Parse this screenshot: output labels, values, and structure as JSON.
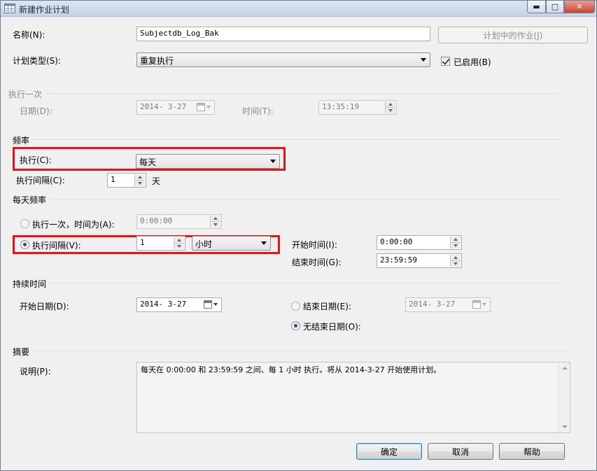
{
  "window": {
    "title": "新建作业计划",
    "min_label": "▬",
    "max_label": "□",
    "close_label": "✕"
  },
  "name": {
    "label": "名称(N):",
    "value": "Subjectdb_Log_Bak",
    "jobs_button": "计划中的作业(J)"
  },
  "schedule_type": {
    "label": "计划类型(S):",
    "value": "重复执行",
    "enabled_label": "已启用(B)",
    "enabled_checked": true
  },
  "one_time": {
    "section": "执行一次",
    "date_label": "日期(D):",
    "date_value": "2014- 3-27",
    "time_label": "时间(T):",
    "time_value": "13:35:19"
  },
  "frequency": {
    "section": "频率",
    "occurs_label": "执行(C):",
    "occurs_value": "每天",
    "recurs_label": "执行间隔(C):",
    "recurs_value": "1",
    "recurs_unit": "天"
  },
  "daily_frequency": {
    "section": "每天频率",
    "once_label": "执行一次，时间为(A):",
    "once_value": "0:00:00",
    "every_label": "执行间隔(V):",
    "every_value": "1",
    "every_unit": "小时",
    "start_time_label": "开始时间(I):",
    "start_time_value": "0:00:00",
    "end_time_label": "结束时间(G):",
    "end_time_value": "23:59:59",
    "selected": "every"
  },
  "duration": {
    "section": "持续时间",
    "start_date_label": "开始日期(D):",
    "start_date_value": "2014- 3-27",
    "end_date_label": "结束日期(E):",
    "end_date_value": "2014- 3-27",
    "no_end_label": "无结束日期(O):",
    "selected": "no_end"
  },
  "summary": {
    "section": "摘要",
    "desc_label": "说明(P):",
    "desc_value": "每天在 0:00:00 和 23:59:59 之间、每 1 小时 执行。将从 2014-3-27 开始使用计划。"
  },
  "buttons": {
    "ok": "确定",
    "cancel": "取消",
    "help": "帮助"
  },
  "colors": {
    "highlight_box": "#e8141c",
    "dialog_bg": "#f0f0f0"
  }
}
